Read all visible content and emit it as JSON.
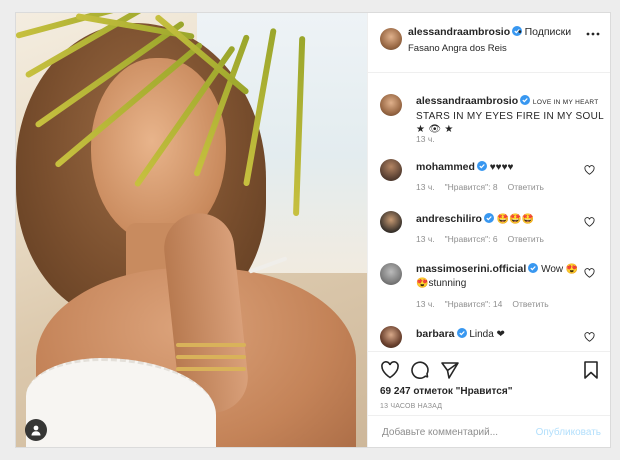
{
  "post": {
    "username": "alessandraambrosio",
    "follow_label": "• Подписки",
    "location": "Fasano Angra dos Reis"
  },
  "caption": {
    "username": "alessandraambrosio",
    "line1": "LOVE IN MY HEART",
    "line2": "STARS IN MY EYES FIRE IN MY SOUL ★ 👁 ★",
    "time": "13 ч."
  },
  "comments": [
    {
      "username": "mohammed",
      "text": "♥♥♥♥",
      "time": "13 ч.",
      "likes": "\"Нравится\": 8",
      "reply": "Ответить"
    },
    {
      "username": "andreschiliro",
      "text": "🤩🤩🤩",
      "time": "13 ч.",
      "likes": "\"Нравится\": 6",
      "reply": "Ответить"
    },
    {
      "username": "massimoserini.official",
      "text_line1": "Wow 😍",
      "text_line2": "😍stunning",
      "time": "13 ч.",
      "likes": "\"Нравится\": 14",
      "reply": "Ответить"
    },
    {
      "username": "barbara",
      "text": "Linda ❤"
    }
  ],
  "stats": {
    "likes": "69 247 отметок \"Нравится\"",
    "posted_ago": "13 ЧАСОВ НАЗАД"
  },
  "compose": {
    "placeholder": "Добавьте комментарий...",
    "publish_label": "Опубликовать"
  },
  "colors": {
    "verified": "#3897f0",
    "publish_disabled": "#b2dffc",
    "heart_red": "#ed4956"
  }
}
